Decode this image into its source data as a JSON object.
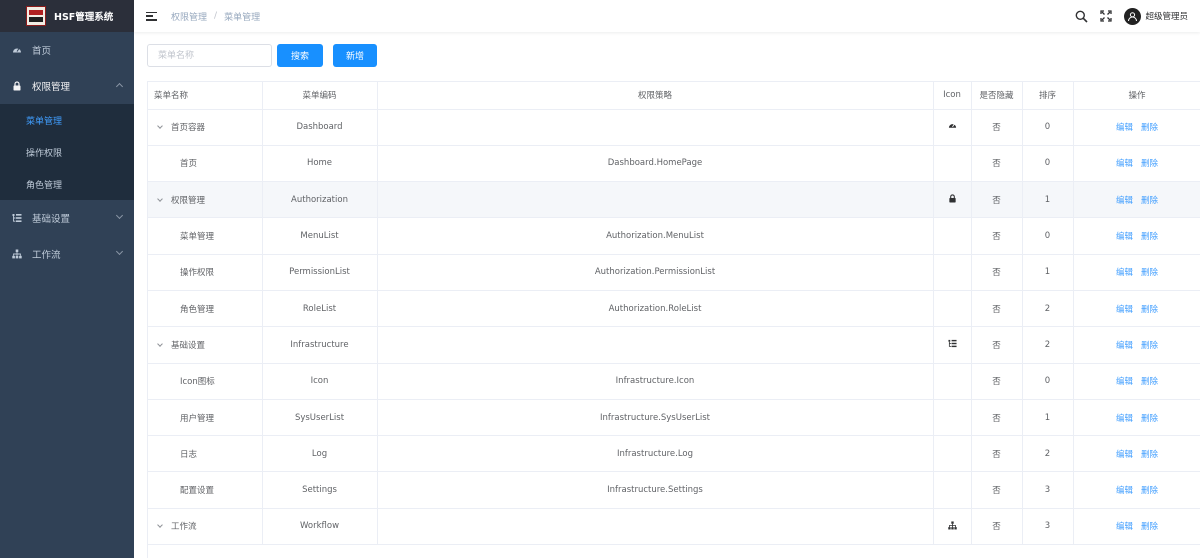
{
  "app": {
    "title": "HSF管理系统"
  },
  "sidebar": {
    "items": [
      {
        "label": "首页",
        "icon": "dashboard-icon"
      },
      {
        "label": "权限管理",
        "icon": "lock-icon",
        "expanded": true,
        "children": [
          {
            "label": "菜单管理",
            "active": true
          },
          {
            "label": "操作权限"
          },
          {
            "label": "角色管理"
          }
        ]
      },
      {
        "label": "基础设置",
        "icon": "list-tree-icon"
      },
      {
        "label": "工作流",
        "icon": "org-chart-icon"
      }
    ]
  },
  "navbar": {
    "breadcrumb": [
      "权限管理",
      "菜单管理"
    ],
    "user": "超级管理员"
  },
  "toolbar": {
    "search_placeholder": "菜单名称",
    "search_label": "搜索",
    "add_label": "新增"
  },
  "table": {
    "headers": [
      "菜单名称",
      "菜单编码",
      "权限策略",
      "Icon",
      "是否隐藏",
      "排序",
      "操作"
    ],
    "edit_label": "编辑",
    "delete_label": "删除",
    "rows": [
      {
        "name": "首页容器",
        "code": "Dashboard",
        "policy": "",
        "icon": "dashboard-icon",
        "hidden": "否",
        "sort": "0",
        "parent": true
      },
      {
        "name": "首页",
        "code": "Home",
        "policy": "Dashboard.HomePage",
        "icon": "",
        "hidden": "否",
        "sort": "0",
        "parent": false
      },
      {
        "name": "权限管理",
        "code": "Authorization",
        "policy": "",
        "icon": "lock-icon",
        "hidden": "否",
        "sort": "1",
        "parent": true
      },
      {
        "name": "菜单管理",
        "code": "MenuList",
        "policy": "Authorization.MenuList",
        "icon": "",
        "hidden": "否",
        "sort": "0",
        "parent": false
      },
      {
        "name": "操作权限",
        "code": "PermissionList",
        "policy": "Authorization.PermissionList",
        "icon": "",
        "hidden": "否",
        "sort": "1",
        "parent": false
      },
      {
        "name": "角色管理",
        "code": "RoleList",
        "policy": "Authorization.RoleList",
        "icon": "",
        "hidden": "否",
        "sort": "2",
        "parent": false
      },
      {
        "name": "基础设置",
        "code": "Infrastructure",
        "policy": "",
        "icon": "list-tree-icon",
        "hidden": "否",
        "sort": "2",
        "parent": true
      },
      {
        "name": "Icon图标",
        "code": "Icon",
        "policy": "Infrastructure.Icon",
        "icon": "",
        "hidden": "否",
        "sort": "0",
        "parent": false
      },
      {
        "name": "用户管理",
        "code": "SysUserList",
        "policy": "Infrastructure.SysUserList",
        "icon": "",
        "hidden": "否",
        "sort": "1",
        "parent": false
      },
      {
        "name": "日志",
        "code": "Log",
        "policy": "Infrastructure.Log",
        "icon": "",
        "hidden": "否",
        "sort": "2",
        "parent": false
      },
      {
        "name": "配置设置",
        "code": "Settings",
        "policy": "Infrastructure.Settings",
        "icon": "",
        "hidden": "否",
        "sort": "3",
        "parent": false
      },
      {
        "name": "工作流",
        "code": "Workflow",
        "policy": "",
        "icon": "org-chart-icon",
        "hidden": "否",
        "sort": "3",
        "parent": true
      }
    ]
  },
  "colors": {
    "sidebar_bg": "#304156",
    "accent": "#409eff",
    "button": "#1890ff"
  }
}
